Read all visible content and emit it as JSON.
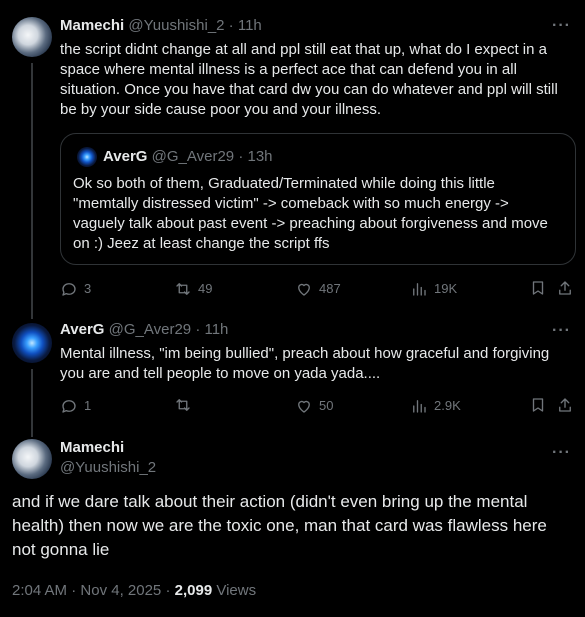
{
  "tweets": [
    {
      "name": "Mamechi",
      "handle": "@Yuushishi_2",
      "time": "11h",
      "text": "the script didnt change at all and ppl still eat that up, what do I expect in a space where mental illness is a perfect ace that can defend you in all situation. Once you have that card dw you can do whatever and ppl will still be by your side cause poor you and your illness.",
      "quote": {
        "name": "AverG",
        "handle": "@G_Aver29",
        "time": "13h",
        "text": "Ok so both of them, Graduated/Terminated while doing this little \"memtally distressed victim\" -> comeback with so much energy -> vaguely talk about past event -> preaching about forgiveness and move on :) Jeez at least change the script ffs"
      },
      "replies": "3",
      "reposts": "49",
      "likes": "487",
      "views": "19K"
    },
    {
      "name": "AverG",
      "handle": "@G_Aver29",
      "time": "11h",
      "text": "Mental illness, \"im being bullied\", preach about how graceful and forgiving you are and tell people to move on yada yada....",
      "replies": "1",
      "reposts": "",
      "likes": "50",
      "views": "2.9K"
    }
  ],
  "main": {
    "name": "Mamechi",
    "handle": "@Yuushishi_2",
    "text": "and if we dare talk about their action (didn't even bring up the mental health) then now we are the toxic one, man that card was flawless here not gonna lie",
    "time": "2:04 AM",
    "date": "Nov 4, 2025",
    "views_count": "2,099",
    "views_label": "Views"
  },
  "separator": "·",
  "more_glyph": "···",
  "colors": {
    "background": "#000000",
    "text": "#e7e9ea",
    "muted": "#71767b",
    "border": "#2f3336"
  },
  "icons": [
    "reply-icon",
    "repost-icon",
    "like-icon",
    "views-icon",
    "bookmark-icon",
    "share-icon",
    "more-icon"
  ]
}
